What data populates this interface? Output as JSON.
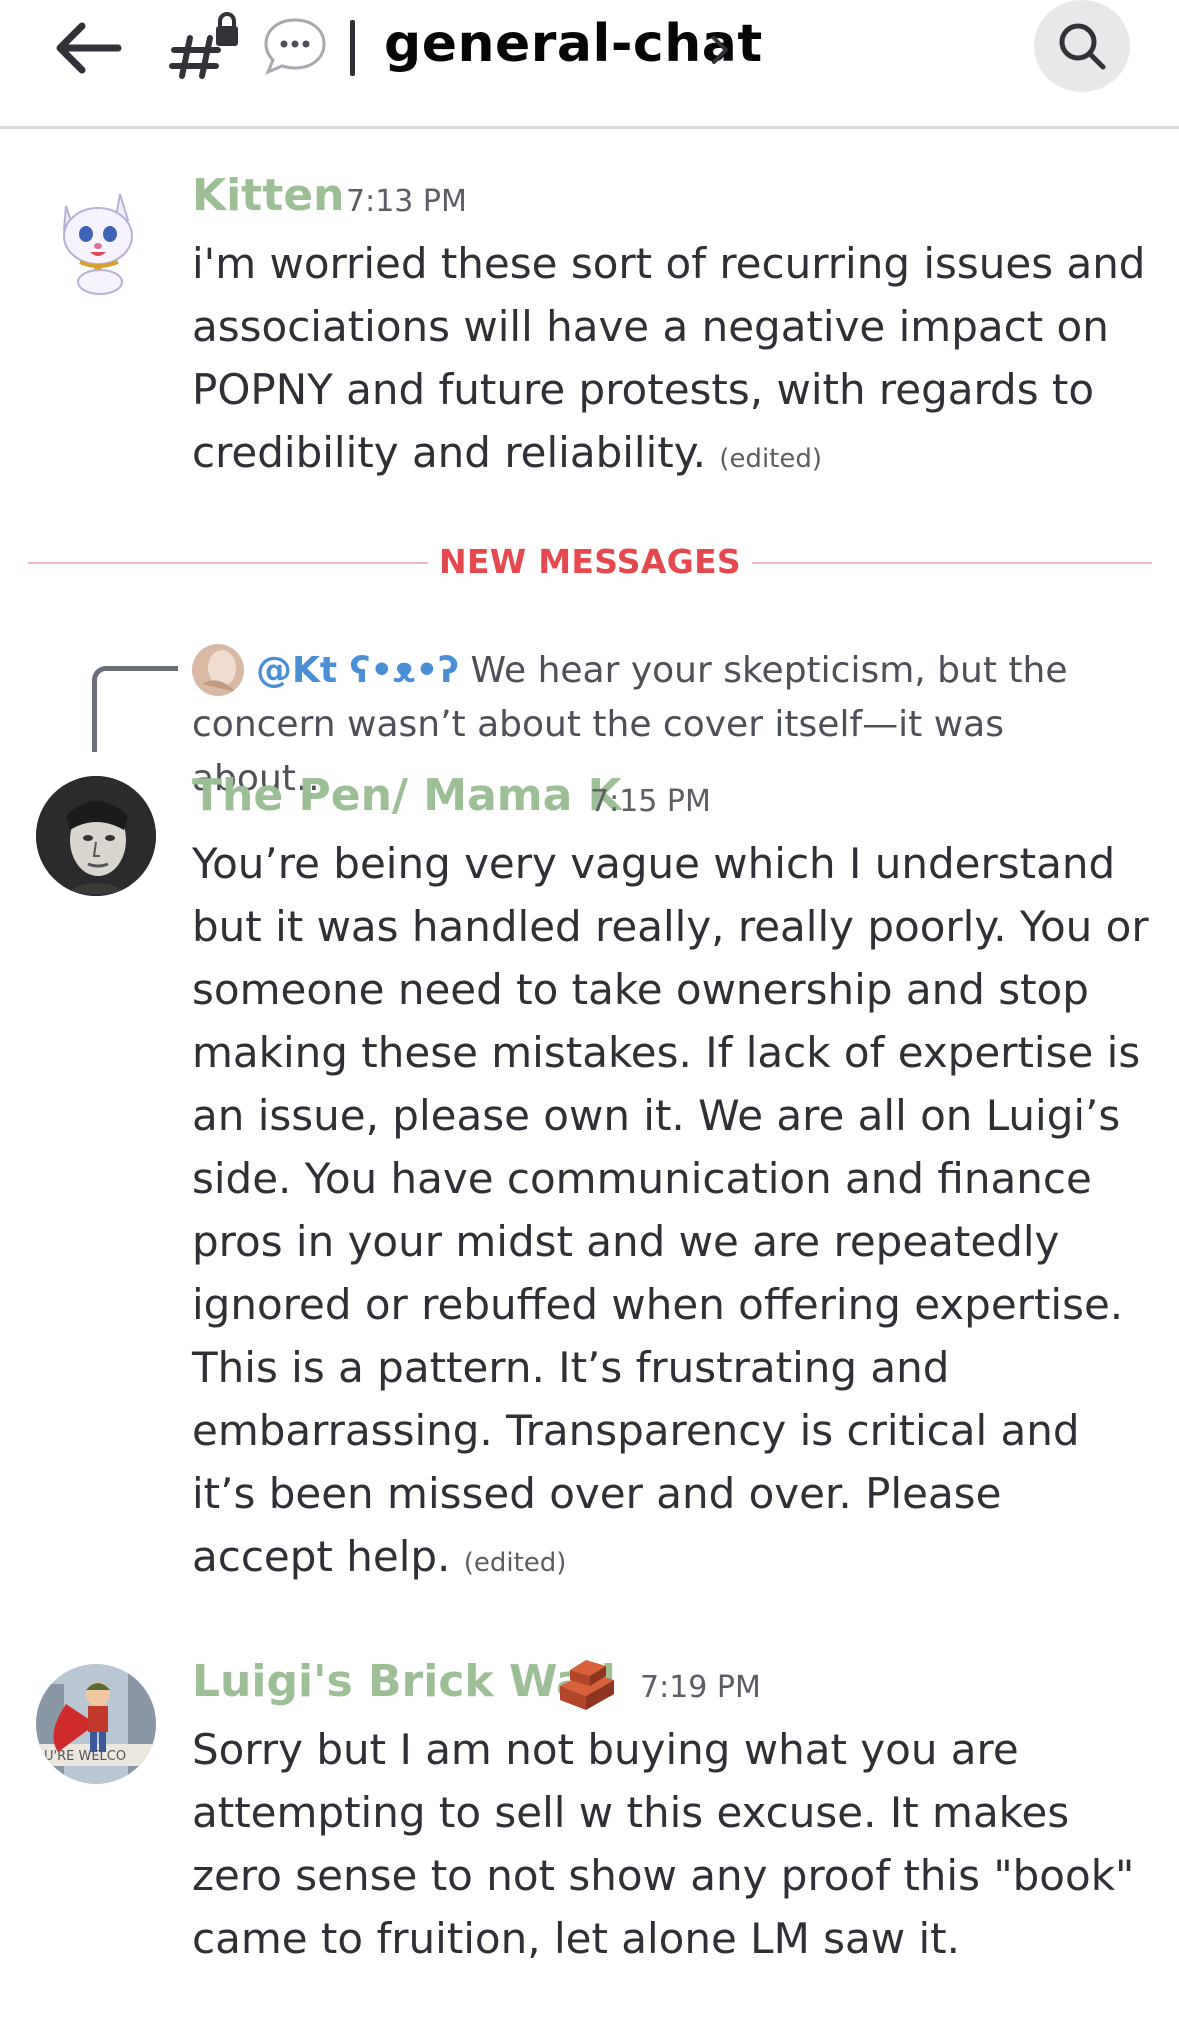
{
  "header": {
    "channel_name": "general-chat",
    "icons": [
      "back-arrow-icon",
      "locked-channel-icon",
      "thread-bubble-icon",
      "chevron-right-icon",
      "search-icon"
    ]
  },
  "messages": [
    {
      "username": "Kitten",
      "time": "7:13 PM",
      "text": "i'm worried these sort of recurring issues and associations will have a negative impact on POPNY and future protests, with regards to credibility and reliability.",
      "edited": "(edited)"
    },
    {
      "reply_mention": "@Kt ʕ•ᴥ•ʔ",
      "reply_preview": " We hear your skepticism, but the concern wasn’t about the cover itself—it was about…",
      "username": "The Pen/ Mama K",
      "time": "7:15 PM",
      "text": "You’re being very vague which I understand but it was handled really, really poorly.  You  or someone need to take ownership and stop making these mistakes.  If lack of expertise is an issue, please own it.  We are all on Luigi’s side.  You have communication and finance pros in your midst and we are repeatedly ignored or rebuffed when offering expertise.  This is a pattern.  It’s frustrating and embarrassing.  Transparency is critical and it’s been missed over and over.  Please accept help.",
      "edited": "(edited)"
    },
    {
      "username": "Luigi's Brick Wall",
      "time": "7:19 PM",
      "text": "Sorry but I am not buying what you are attempting to sell w this excuse. It makes zero sense to not show any proof this \"book\" came to fruition, let alone LM saw it."
    }
  ],
  "new_messages_label": "NEW MESSAGES",
  "colors": {
    "username": "#9dbf95",
    "new_messages": "#e5484d",
    "mention": "#4a8fd6"
  }
}
